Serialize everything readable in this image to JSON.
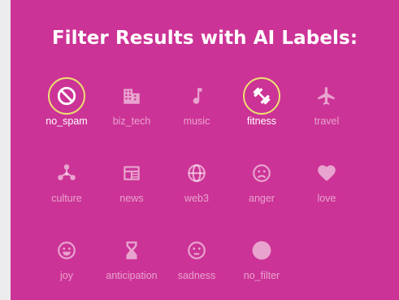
{
  "title": "Filter Results with AI Labels:",
  "colors": {
    "background": "#cc3396",
    "selected_ring": "#ecdf73"
  },
  "filters": [
    {
      "label": "no_spam",
      "icon": "no-entry-icon",
      "selected": true
    },
    {
      "label": "biz_tech",
      "icon": "building-icon",
      "selected": false
    },
    {
      "label": "music",
      "icon": "music-note-icon",
      "selected": false
    },
    {
      "label": "fitness",
      "icon": "dumbbell-icon",
      "selected": true
    },
    {
      "label": "travel",
      "icon": "airplane-icon",
      "selected": false
    },
    {
      "label": "culture",
      "icon": "culture-icon",
      "selected": false
    },
    {
      "label": "news",
      "icon": "newspaper-icon",
      "selected": false
    },
    {
      "label": "web3",
      "icon": "globe-icon",
      "selected": false
    },
    {
      "label": "anger",
      "icon": "frown-face-icon",
      "selected": false
    },
    {
      "label": "love",
      "icon": "heart-icon",
      "selected": false
    },
    {
      "label": "joy",
      "icon": "smile-face-icon",
      "selected": false
    },
    {
      "label": "anticipation",
      "icon": "hourglass-icon",
      "selected": false
    },
    {
      "label": "sadness",
      "icon": "neutral-face-icon",
      "selected": false
    },
    {
      "label": "no_filter",
      "icon": "circle-icon",
      "selected": false
    }
  ]
}
